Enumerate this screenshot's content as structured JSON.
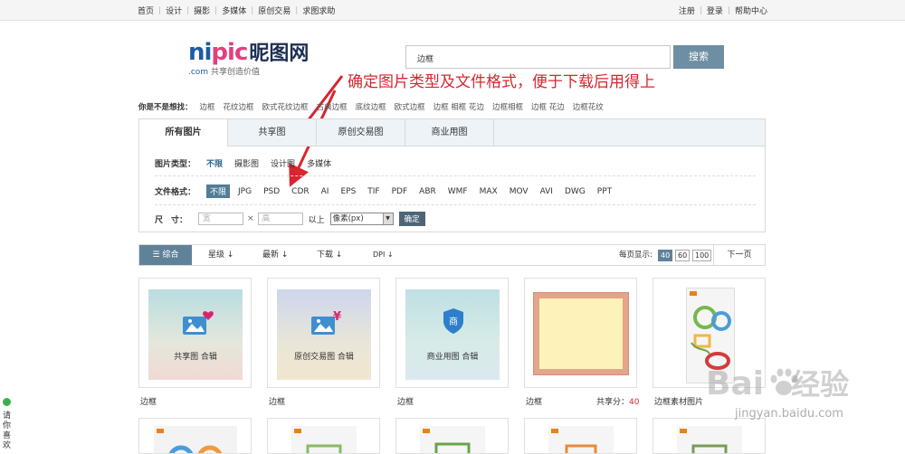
{
  "topnav": {
    "left": [
      "首页",
      "设计",
      "摄影",
      "多媒体",
      "原创交易",
      "求图求助"
    ],
    "right": [
      "注册",
      "登录",
      "帮助中心"
    ]
  },
  "logo": {
    "brand_latin_a": "ni",
    "brand_latin_b": "pic",
    "brand_cn": "昵图网",
    "com": ".com",
    "slogan": "共享创造价值"
  },
  "search": {
    "value": "边框",
    "button": "搜索"
  },
  "annotation": "确定图片类型及文件格式，便于下载后用得上",
  "related": {
    "label": "你是不是想找：",
    "keywords": [
      "边框",
      "花纹边框",
      "欧式花纹边框",
      "古典边框",
      "底纹边框",
      "欧式边框",
      "边框 相框 花边",
      "边框相框",
      "边框 花边",
      "边框花纹"
    ]
  },
  "filter": {
    "tabs": [
      "所有图片",
      "共享图",
      "原创交易图",
      "商业用图"
    ],
    "type_label": "图片类型：",
    "types": [
      "不限",
      "摄影图",
      "设计图",
      "多媒体"
    ],
    "format_label": "文件格式：",
    "formats": [
      "不限",
      "JPG",
      "PSD",
      "CDR",
      "AI",
      "EPS",
      "TIF",
      "PDF",
      "ABR",
      "WMF",
      "MAX",
      "MOV",
      "AVI",
      "DWG",
      "PPT"
    ],
    "size_label": "尺　寸：",
    "width_ph": "宽",
    "times": "×",
    "height_ph": "高",
    "above": "以上",
    "unit": "像素(px)",
    "ok": "确定"
  },
  "sortbar": {
    "sorts": [
      "综合",
      "星级",
      "最新",
      "下载",
      "DPI"
    ],
    "per_page_label": "每页显示:",
    "per_page": [
      "40",
      "60",
      "100"
    ],
    "next": "下一页"
  },
  "cards": [
    {
      "thumb_text": "共享图 合辑",
      "caption": "边框"
    },
    {
      "thumb_text": "原创交易图 合辑",
      "caption": "边框"
    },
    {
      "thumb_text": "商业用图 合辑",
      "caption": "边框"
    },
    {
      "caption": "边框",
      "share_label": "共享分：",
      "share_value": "40"
    },
    {
      "caption": "边框素材图片"
    }
  ],
  "side_badge": [
    "请",
    "你",
    "喜",
    "欢"
  ],
  "watermark": {
    "brand": "Bai",
    "brand_cn": "经验",
    "url": "jingyan.baidu.com"
  },
  "colors": {
    "accent": "#5f8299",
    "annotation": "#d8252f",
    "logo_blue": "#1d5aa8",
    "logo_pink": "#e23f7d"
  }
}
